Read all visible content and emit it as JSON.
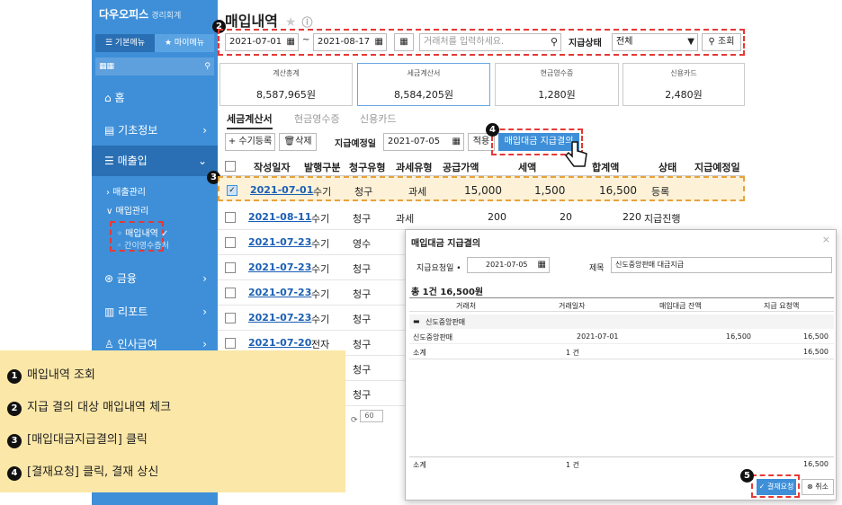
{
  "sidebar": {
    "brand": "다우오피스",
    "brand_sub": "경리회계",
    "tab_all": "☰ 기본메뉴",
    "tab_my": "★ 마이메뉴",
    "items": [
      {
        "label": "홈"
      },
      {
        "label": "기초정보"
      },
      {
        "label": "매출입"
      },
      {
        "label": "금융"
      },
      {
        "label": "리포트"
      },
      {
        "label": "인사급여"
      }
    ],
    "sales_mgmt": "› 매출관리",
    "buy_mgmt": "∨ 매입관리",
    "buy_list": "◦ 매입내역 ✓",
    "buy_receipt": "◦ 간이영수증처"
  },
  "page": {
    "title": "매입내역"
  },
  "search": {
    "date_from": "2021-07-01",
    "date_to": "2021-08-17",
    "placeholder": "거래처를 입력하세요.",
    "pay_status_label": "지급상태",
    "pay_status_value": "전체",
    "search_button": "조회"
  },
  "summary": [
    {
      "label": "계산총계",
      "value": "8,587,965원"
    },
    {
      "label": "세금계산서",
      "value": "8,584,205원"
    },
    {
      "label": "현금영수증",
      "value": "1,280원"
    },
    {
      "label": "신용카드",
      "value": "2,480원"
    }
  ],
  "tabs": [
    "세금계산서",
    "현금영수증",
    "신용카드"
  ],
  "toolbar": {
    "add": "+ 수기등록",
    "delete": "삭제",
    "pay_date_label": "지급예정일",
    "pay_date": "2021-07-05",
    "apply": "적용",
    "pay_resolution": "매입대금 지급결의"
  },
  "table": {
    "headers": [
      "작성일자",
      "발행구분",
      "청구유형",
      "과세유형",
      "공급가액",
      "세액",
      "합계액",
      "상태",
      "지급예정일"
    ],
    "rows": [
      {
        "date": "2021-07-01",
        "issue": "수기",
        "claim": "청구",
        "tax": "과세",
        "supply": "15,000",
        "vat": "1,500",
        "total": "16,500",
        "status": "등록"
      },
      {
        "date": "2021-08-11",
        "issue": "수기",
        "claim": "청구",
        "tax": "과세",
        "supply": "200",
        "vat": "20",
        "total": "220",
        "status": "지급진행"
      },
      {
        "date": "2021-07-23",
        "issue": "수기",
        "claim": "영수"
      },
      {
        "date": "2021-07-23",
        "issue": "수기",
        "claim": "청구"
      },
      {
        "date": "2021-07-23",
        "issue": "수기",
        "claim": "청구"
      },
      {
        "date": "2021-07-23",
        "issue": "수기",
        "claim": "청구"
      },
      {
        "date": "2021-07-20",
        "issue": "전자",
        "claim": "청구"
      },
      {
        "claim": "청구"
      },
      {
        "claim": "청구"
      }
    ],
    "page_size": "60"
  },
  "dialog": {
    "title": "매입대금 지급결의",
    "req_date_label": "지급요청일 •",
    "req_date": "2021-07-05",
    "subject_label": "제목",
    "subject": "신도중앙판매 대금지급",
    "total_line": "총 1건 16,500원",
    "headers": [
      "거래처",
      "거래일자",
      "매입대금 잔액",
      "지급 요청액"
    ],
    "group": "신도중앙판매",
    "row": {
      "vendor": "신도중앙판매",
      "date": "2021-07-01",
      "balance": "16,500",
      "request": "16,500"
    },
    "subtotal": {
      "label": "소계",
      "count": "1 건",
      "amount": "16,500"
    },
    "footer": {
      "label": "소계",
      "count": "1 건",
      "amount": "16,500"
    },
    "ok": "결재요청",
    "cancel": "취소"
  },
  "legend": [
    "매입내역 조회",
    "지급 결의 대상 매입내역 체크",
    "[매입대금지급결의] 클릭",
    "[결재요청] 클릭, 결재 상신"
  ],
  "badges": [
    "1",
    "2",
    "3",
    "4",
    "5"
  ],
  "colors": {
    "accent": "#3e8fd8",
    "highlight": "#e53935",
    "legend_bg": "#fbe7a7"
  }
}
